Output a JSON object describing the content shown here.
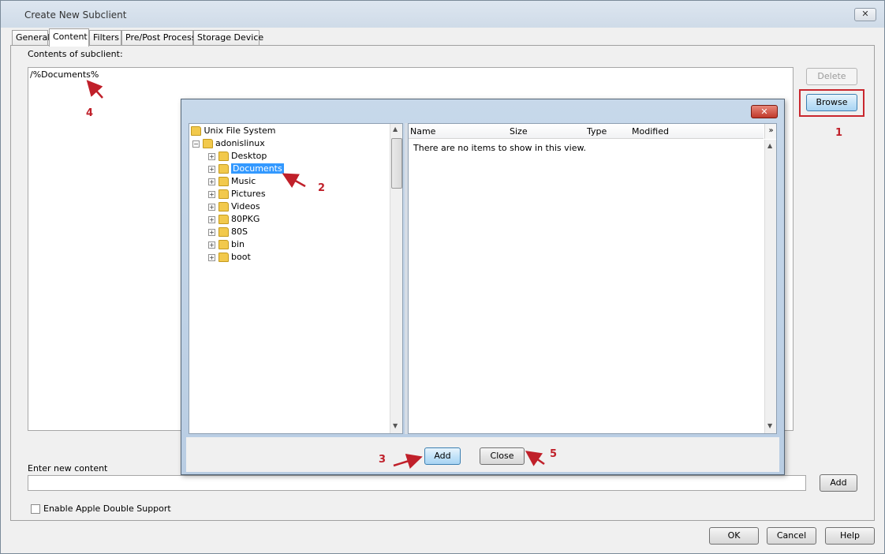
{
  "window": {
    "title": "Create New Subclient",
    "close_label": "✕"
  },
  "tabs": [
    {
      "label": "General"
    },
    {
      "label": "Content"
    },
    {
      "label": "Filters"
    },
    {
      "label": "Pre/Post Process"
    },
    {
      "label": "Storage Device"
    }
  ],
  "content": {
    "contents_label": "Contents of subclient:",
    "items": [
      "/%Documents%"
    ],
    "delete_label": "Delete",
    "browse_label": "Browse",
    "enter_label": "Enter new content",
    "enter_value": "",
    "add_label": "Add",
    "apple_double_label": "Enable Apple Double Support"
  },
  "dialog": {
    "close_label": "✕",
    "tree": [
      {
        "label": "Unix File System"
      },
      {
        "label": "adonislinux"
      },
      {
        "label": "Desktop"
      },
      {
        "label": "Documents"
      },
      {
        "label": "Music"
      },
      {
        "label": "Pictures"
      },
      {
        "label": "Videos"
      },
      {
        "label": "80PKG"
      },
      {
        "label": "80S"
      },
      {
        "label": "bin"
      },
      {
        "label": "boot"
      }
    ],
    "columns": [
      "Name",
      "Size",
      "Type",
      "Modified"
    ],
    "empty_message": "There are no items to show in this view.",
    "add_label": "Add",
    "close_button_label": "Close"
  },
  "footer": {
    "ok_label": "OK",
    "cancel_label": "Cancel",
    "help_label": "Help"
  },
  "annotations": [
    "1",
    "2",
    "3",
    "4",
    "5"
  ],
  "colors": {
    "annotation": "#c0202a",
    "selection": "#3399ff"
  },
  "icons": [
    "folder-icon",
    "expand-icon",
    "collapse-icon",
    "chevron-double-down-icon",
    "arrow-annotation-icon"
  ]
}
